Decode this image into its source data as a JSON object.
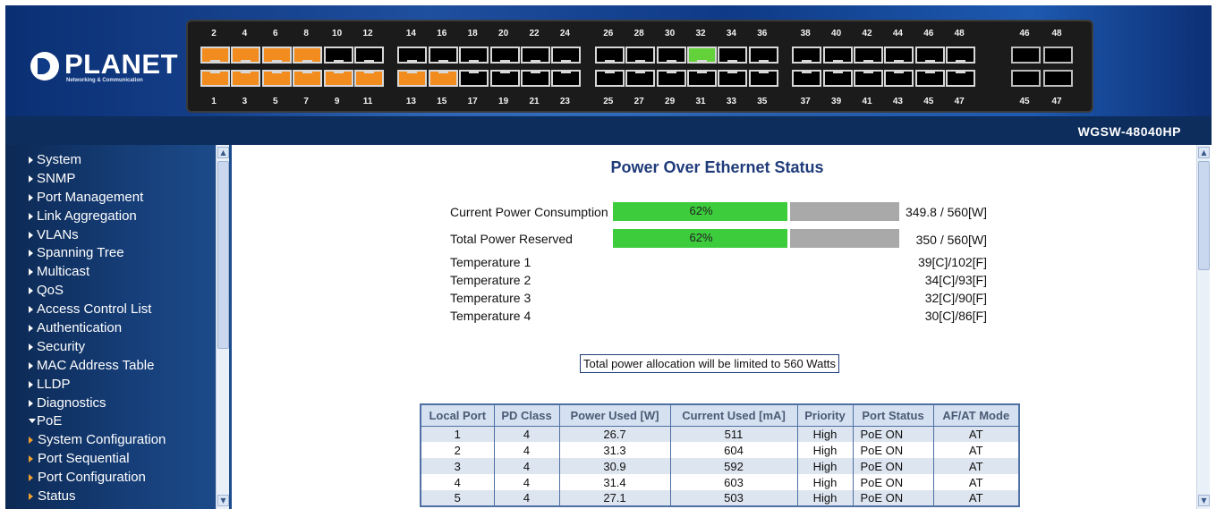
{
  "header": {
    "brand": "PLANET",
    "tagline": "Networking & Communication",
    "model": "WGSW-48040HP",
    "ports_top": [
      "2",
      "4",
      "6",
      "8",
      "10",
      "12",
      "14",
      "16",
      "18",
      "20",
      "22",
      "24",
      "26",
      "28",
      "30",
      "32",
      "34",
      "36",
      "38",
      "40",
      "42",
      "44",
      "46",
      "48"
    ],
    "ports_bottom": [
      "1",
      "3",
      "5",
      "7",
      "9",
      "11",
      "13",
      "15",
      "17",
      "19",
      "21",
      "23",
      "25",
      "27",
      "29",
      "31",
      "33",
      "35",
      "37",
      "39",
      "41",
      "43",
      "45",
      "47"
    ],
    "sfp_top": [
      "46",
      "48"
    ],
    "sfp_bottom": [
      "45",
      "47"
    ],
    "colors": {
      "port_active_orange": "#f28c1e",
      "port_active_green": "#62d13a",
      "port_idle": "#000000"
    },
    "active_orange_ports": [
      "1",
      "2",
      "3",
      "4",
      "5",
      "6",
      "7",
      "8",
      "9",
      "11",
      "13",
      "15"
    ],
    "active_green_ports": [
      "32"
    ]
  },
  "sidebar": {
    "items": [
      {
        "label": "System",
        "expanded": false
      },
      {
        "label": "SNMP",
        "expanded": false
      },
      {
        "label": "Port Management",
        "expanded": false
      },
      {
        "label": "Link Aggregation",
        "expanded": false
      },
      {
        "label": "VLANs",
        "expanded": false
      },
      {
        "label": "Spanning Tree",
        "expanded": false
      },
      {
        "label": "Multicast",
        "expanded": false
      },
      {
        "label": "QoS",
        "expanded": false
      },
      {
        "label": "Access Control List",
        "expanded": false
      },
      {
        "label": "Authentication",
        "expanded": false
      },
      {
        "label": "Security",
        "expanded": false
      },
      {
        "label": "MAC Address Table",
        "expanded": false
      },
      {
        "label": "LLDP",
        "expanded": false
      },
      {
        "label": "Diagnostics",
        "expanded": false
      },
      {
        "label": "PoE",
        "expanded": true
      }
    ],
    "subitems": [
      {
        "label": "System Configuration"
      },
      {
        "label": "Port Sequential"
      },
      {
        "label": "Port Configuration"
      },
      {
        "label": "Status"
      }
    ]
  },
  "main": {
    "title": "Power Over Ethernet Status",
    "power": [
      {
        "label": "Current Power Consumption",
        "percent_text": "62%",
        "fill": 0.62,
        "value": "349.8 / 560[W]"
      },
      {
        "label": "Total Power Reserved",
        "percent_text": "62%",
        "fill": 0.62,
        "value": "350 / 560[W]"
      }
    ],
    "temperatures": [
      {
        "label": "Temperature 1",
        "value": "39[C]/102[F]"
      },
      {
        "label": "Temperature 2",
        "value": "34[C]/93[F]"
      },
      {
        "label": "Temperature 3",
        "value": "32[C]/90[F]"
      },
      {
        "label": "Temperature 4",
        "value": "30[C]/86[F]"
      }
    ],
    "limit_note": "Total power allocation will be limited to 560 Watts",
    "table": {
      "headers": [
        "Local Port",
        "PD Class",
        "Power Used [W]",
        "Current Used [mA]",
        "Priority",
        "Port Status",
        "AF/AT Mode"
      ],
      "rows": [
        [
          "1",
          "4",
          "26.7",
          "511",
          "High",
          "PoE ON",
          "AT"
        ],
        [
          "2",
          "4",
          "31.3",
          "604",
          "High",
          "PoE ON",
          "AT"
        ],
        [
          "3",
          "4",
          "30.9",
          "592",
          "High",
          "PoE ON",
          "AT"
        ],
        [
          "4",
          "4",
          "31.4",
          "603",
          "High",
          "PoE ON",
          "AT"
        ],
        [
          "5",
          "4",
          "27.1",
          "503",
          "High",
          "PoE ON",
          "AT"
        ]
      ]
    }
  }
}
